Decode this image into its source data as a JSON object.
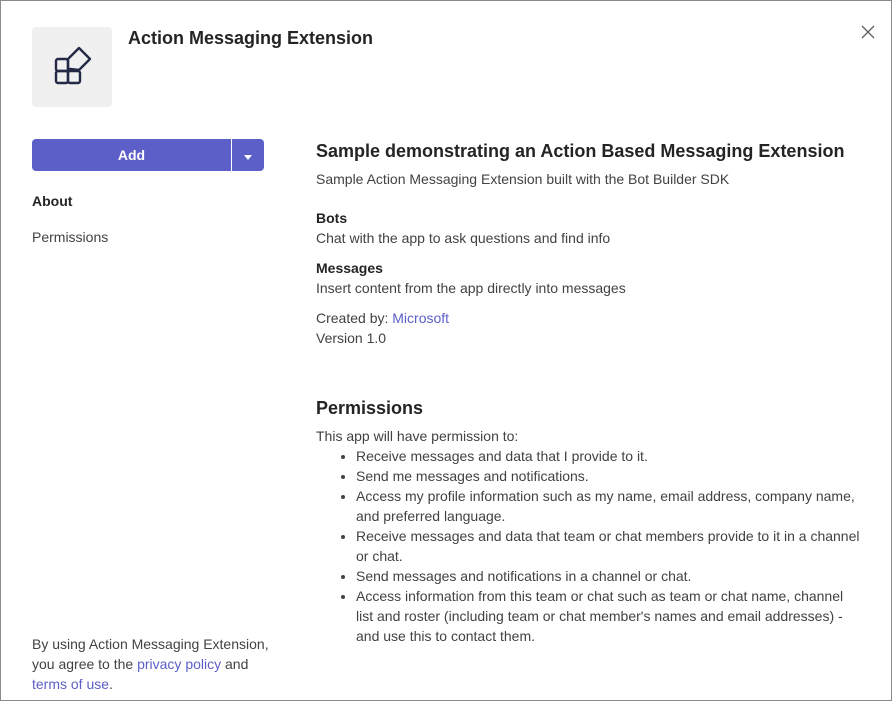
{
  "app": {
    "name": "Action Messaging Extension",
    "icon": "app-blocks-icon"
  },
  "colors": {
    "accent": "#5b5fc7",
    "text_primary": "#242424",
    "text_secondary": "#424242",
    "tile_background": "#f0f0f0"
  },
  "actions": {
    "add_label": "Add",
    "dropdown_icon": "chevron-down-icon",
    "close_icon": "close-icon"
  },
  "nav": {
    "about": "About",
    "permissions": "Permissions"
  },
  "footer": {
    "prefix": "By using Action Messaging Extension, you agree to the",
    "privacy_link": "privacy policy",
    "and": "and",
    "terms_link": "terms of use",
    "period": "."
  },
  "about": {
    "title": "Sample demonstrating an Action Based Messaging Extension",
    "short_description": "Sample Action Messaging Extension built with the Bot Builder SDK",
    "bots_heading": "Bots",
    "bots_text": "Chat with the app to ask questions and find info",
    "messages_heading": "Messages",
    "messages_text": "Insert content from the app directly into messages",
    "created_by_label": "Created by:",
    "created_by_value": "Microsoft",
    "version": "Version 1.0"
  },
  "permissions": {
    "title": "Permissions",
    "intro": "This app will have permission to:",
    "items": [
      "Receive messages and data that I provide to it.",
      "Send me messages and notifications.",
      "Access my profile information such as my name, email address, company name, and preferred language.",
      "Receive messages and data that team or chat members provide to it in a channel or chat.",
      "Send messages and notifications in a channel or chat.",
      "Access information from this team or chat such as team or chat name, channel list and roster (including team or chat member's names and email addresses) - and use this to contact them."
    ]
  }
}
